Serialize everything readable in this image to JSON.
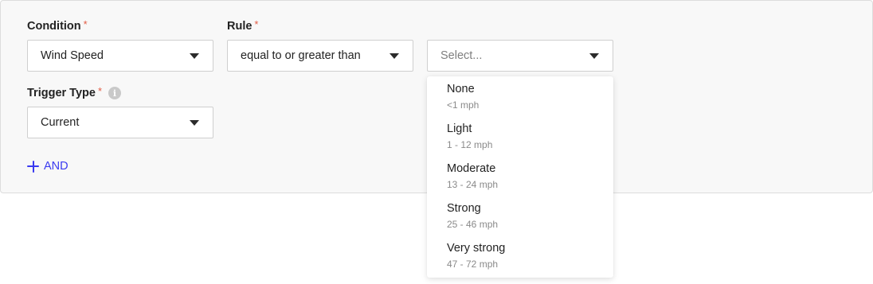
{
  "condition": {
    "label": "Condition",
    "required_mark": "*",
    "value": "Wind Speed"
  },
  "rule": {
    "label": "Rule",
    "required_mark": "*",
    "value": "equal to or greater than"
  },
  "threshold": {
    "placeholder": "Select..."
  },
  "trigger_type": {
    "label": "Trigger Type",
    "required_mark": "*",
    "info_glyph": "i",
    "value": "Current"
  },
  "and_button": {
    "label": "AND"
  },
  "threshold_options": [
    {
      "name": "None",
      "range": "<1 mph"
    },
    {
      "name": "Light",
      "range": "1 - 12 mph"
    },
    {
      "name": "Moderate",
      "range": "13 - 24 mph"
    },
    {
      "name": "Strong",
      "range": "25 - 46 mph"
    },
    {
      "name": "Very strong",
      "range": "47 - 72 mph"
    }
  ],
  "colors": {
    "accent": "#3a3af0",
    "required": "#e25c45",
    "panel_bg": "#f8f8f8",
    "border": "#cfcfcf"
  }
}
